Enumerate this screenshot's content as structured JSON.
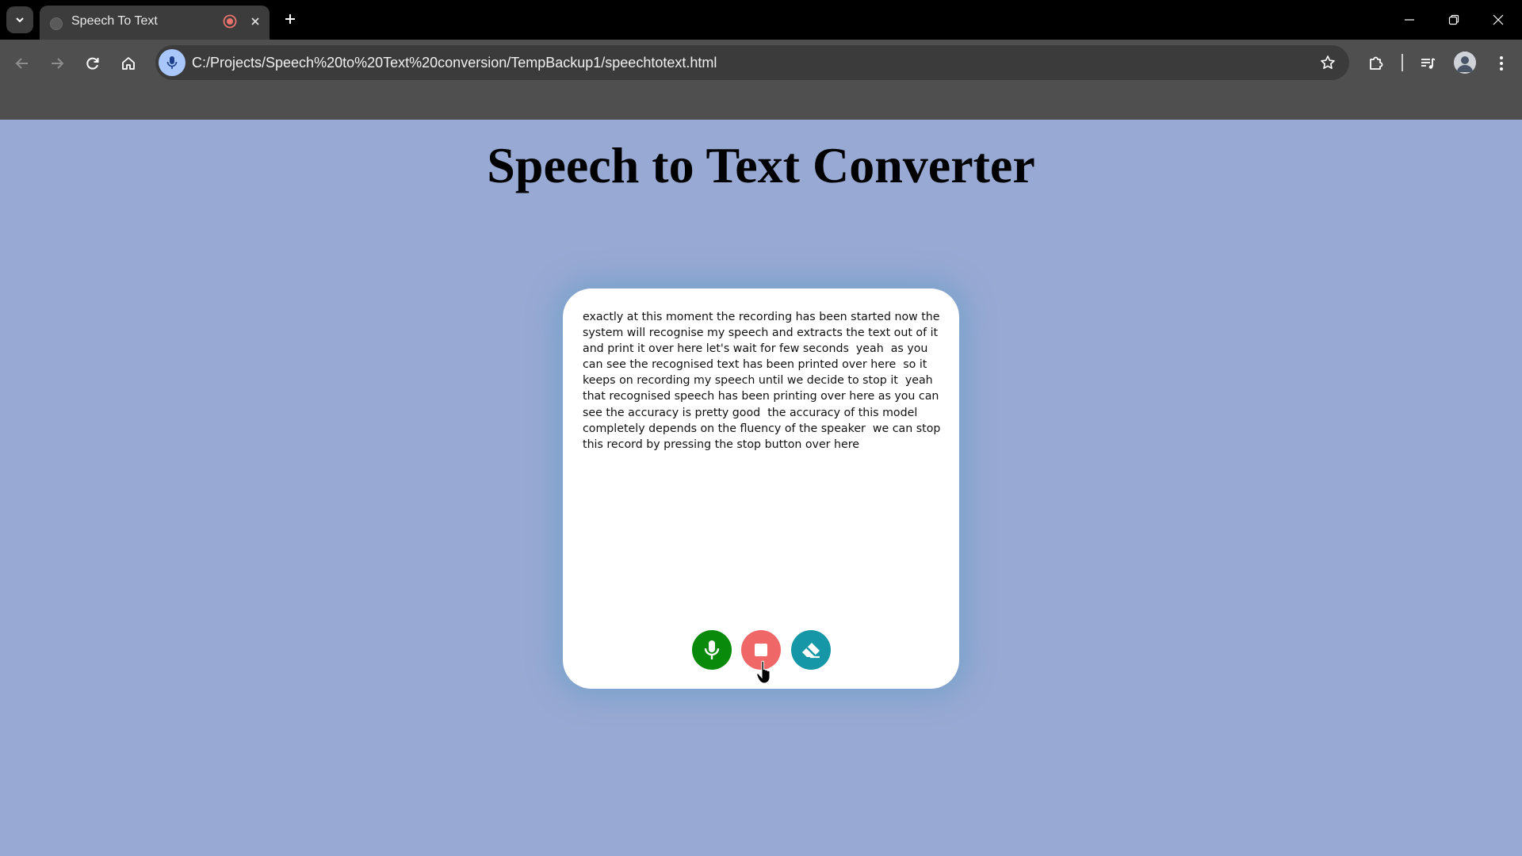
{
  "browser": {
    "tab": {
      "title": "Speech To Text"
    },
    "address_bar": {
      "url": "C:/Projects/Speech%20to%20Text%20conversion/TempBackup1/speechtotext.html"
    },
    "icons": {
      "tab_list": "chevron-down-icon",
      "recording": "recording-indicator-icon",
      "close_tab": "close-icon",
      "new_tab": "plus-icon",
      "back": "back-arrow-icon",
      "forward": "forward-arrow-icon",
      "reload": "reload-icon",
      "home": "home-icon",
      "site_info": "microphone-icon",
      "bookmark": "star-icon",
      "extensions": "puzzle-icon",
      "media": "media-controls-icon",
      "profile": "avatar",
      "menu": "kebab-menu-icon"
    }
  },
  "page": {
    "title": "Speech to Text Converter",
    "transcript": "exactly at this moment the recording has been started now the system will recognise my speech and extracts the text out of it and print it over here let's wait for few seconds  yeah  as you can see the recognised text has been printed over here  so it keeps on recording my speech until we decide to stop it  yeah that recognised speech has been printing over here as you can see the accuracy is pretty good  the accuracy of this model completely depends on the fluency of the speaker  we can stop this record by pressing the stop button over here",
    "controls": {
      "start_icon": "microphone-icon",
      "stop_icon": "stop-icon",
      "clear_icon": "eraser-icon"
    }
  },
  "colors": {
    "page_background": "#98a9d4",
    "start_button": "#0a8a0a",
    "stop_button": "#f06767",
    "clear_button": "#1597a8",
    "recording_indicator": "#e8736b",
    "site_chip": "#a9c7fa"
  }
}
